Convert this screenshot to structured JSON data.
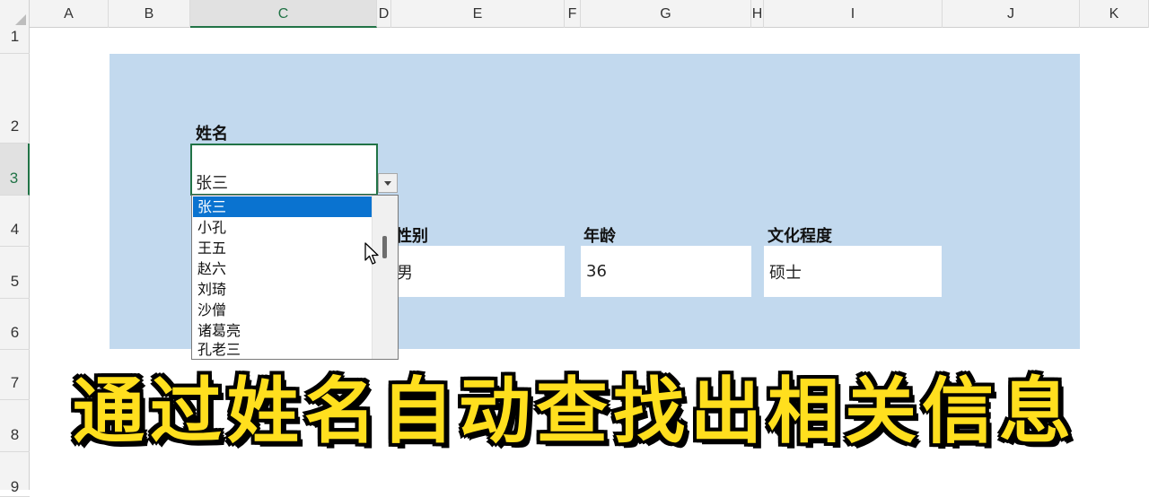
{
  "spreadsheet": {
    "columns": [
      "A",
      "B",
      "C",
      "D",
      "E",
      "F",
      "G",
      "H",
      "I",
      "J",
      "K"
    ],
    "selected_column": "C",
    "rows": [
      "1",
      "2",
      "3",
      "4",
      "5",
      "6",
      "7",
      "8",
      "9"
    ],
    "selected_row": "3"
  },
  "form": {
    "name_label": "姓名",
    "name_value": "张三",
    "gender_label": "性别",
    "gender_value": "男",
    "age_label": "年龄",
    "age_value": "36",
    "education_label": "文化程度",
    "education_value": "硕士"
  },
  "dropdown": {
    "selected": "张三",
    "options": [
      "张三",
      "小孔",
      "王五",
      "赵六",
      "刘琦",
      "沙僧",
      "诸葛亮",
      "孔老三"
    ]
  },
  "caption": "通过姓名自动查找出相关信息",
  "colors": {
    "panel": "#c2d9ee",
    "selection_border": "#217346",
    "list_highlight": "#0a73d0",
    "caption": "#ffdf1e"
  }
}
